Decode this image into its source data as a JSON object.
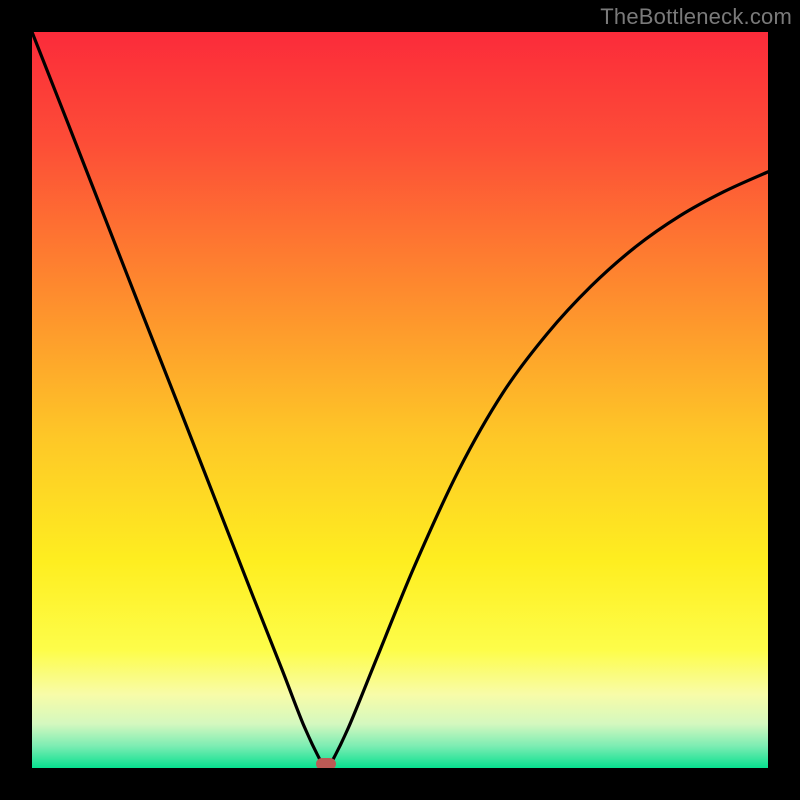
{
  "watermark": {
    "text": "TheBottleneck.com"
  },
  "colors": {
    "frame": "#000000",
    "curve": "#000000",
    "marker": "#bb5a55",
    "gradient_stops": [
      {
        "pct": 0,
        "color": "#fb2b3a"
      },
      {
        "pct": 15,
        "color": "#fd4d37"
      },
      {
        "pct": 35,
        "color": "#fe8a2e"
      },
      {
        "pct": 55,
        "color": "#fec727"
      },
      {
        "pct": 72,
        "color": "#feee20"
      },
      {
        "pct": 84,
        "color": "#fdfd4a"
      },
      {
        "pct": 90,
        "color": "#f8fca8"
      },
      {
        "pct": 94,
        "color": "#d4f8bf"
      },
      {
        "pct": 97,
        "color": "#7dedb3"
      },
      {
        "pct": 100,
        "color": "#07e08f"
      }
    ]
  },
  "chart_data": {
    "type": "line",
    "title": "",
    "xlabel": "",
    "ylabel": "",
    "xlim": [
      0,
      1
    ],
    "ylim": [
      0,
      1
    ],
    "grid": false,
    "series": [
      {
        "name": "bottleneck-curve",
        "x": [
          0.0,
          0.05,
          0.1,
          0.15,
          0.2,
          0.25,
          0.3,
          0.34,
          0.37,
          0.395,
          0.4,
          0.405,
          0.43,
          0.47,
          0.52,
          0.58,
          0.64,
          0.7,
          0.76,
          0.82,
          0.88,
          0.94,
          1.0
        ],
        "y": [
          1.0,
          0.873,
          0.745,
          0.617,
          0.49,
          0.362,
          0.234,
          0.133,
          0.056,
          0.004,
          0.0,
          0.004,
          0.055,
          0.153,
          0.275,
          0.405,
          0.51,
          0.59,
          0.655,
          0.708,
          0.75,
          0.783,
          0.81
        ]
      }
    ],
    "annotations": [
      {
        "name": "min-marker",
        "x": 0.4,
        "y": 0.0
      }
    ]
  }
}
